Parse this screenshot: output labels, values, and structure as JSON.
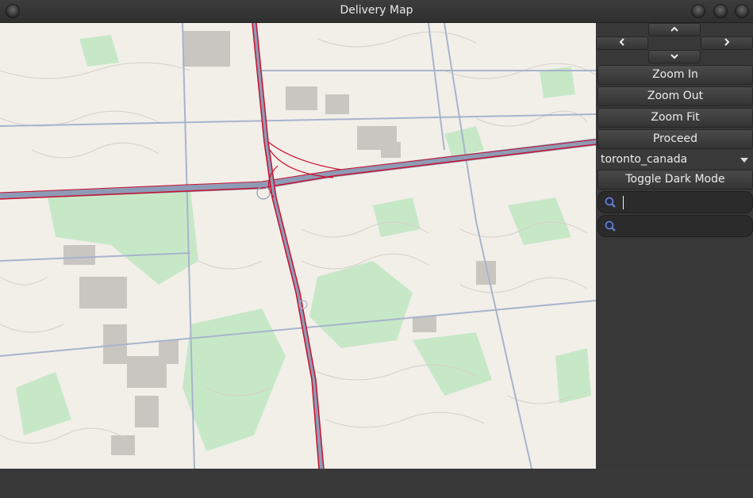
{
  "window": {
    "title": "Delivery Map"
  },
  "nav": {
    "up_icon": "chevron-up-icon",
    "down_icon": "chevron-down-icon",
    "left_icon": "chevron-left-icon",
    "right_icon": "chevron-right-icon"
  },
  "controls": {
    "zoom_in": "Zoom In",
    "zoom_out": "Zoom Out",
    "zoom_fit": "Zoom Fit",
    "proceed": "Proceed",
    "map_select": "toronto_canada",
    "dark_mode": "Toggle Dark Mode"
  },
  "search": {
    "first_value": "",
    "second_value": "",
    "icon": "search-icon"
  },
  "colors": {
    "map_bg": "#f2efe9",
    "highway": "#c8102e",
    "arterial": "#a8b4cc",
    "park": "#c7e8c7"
  }
}
